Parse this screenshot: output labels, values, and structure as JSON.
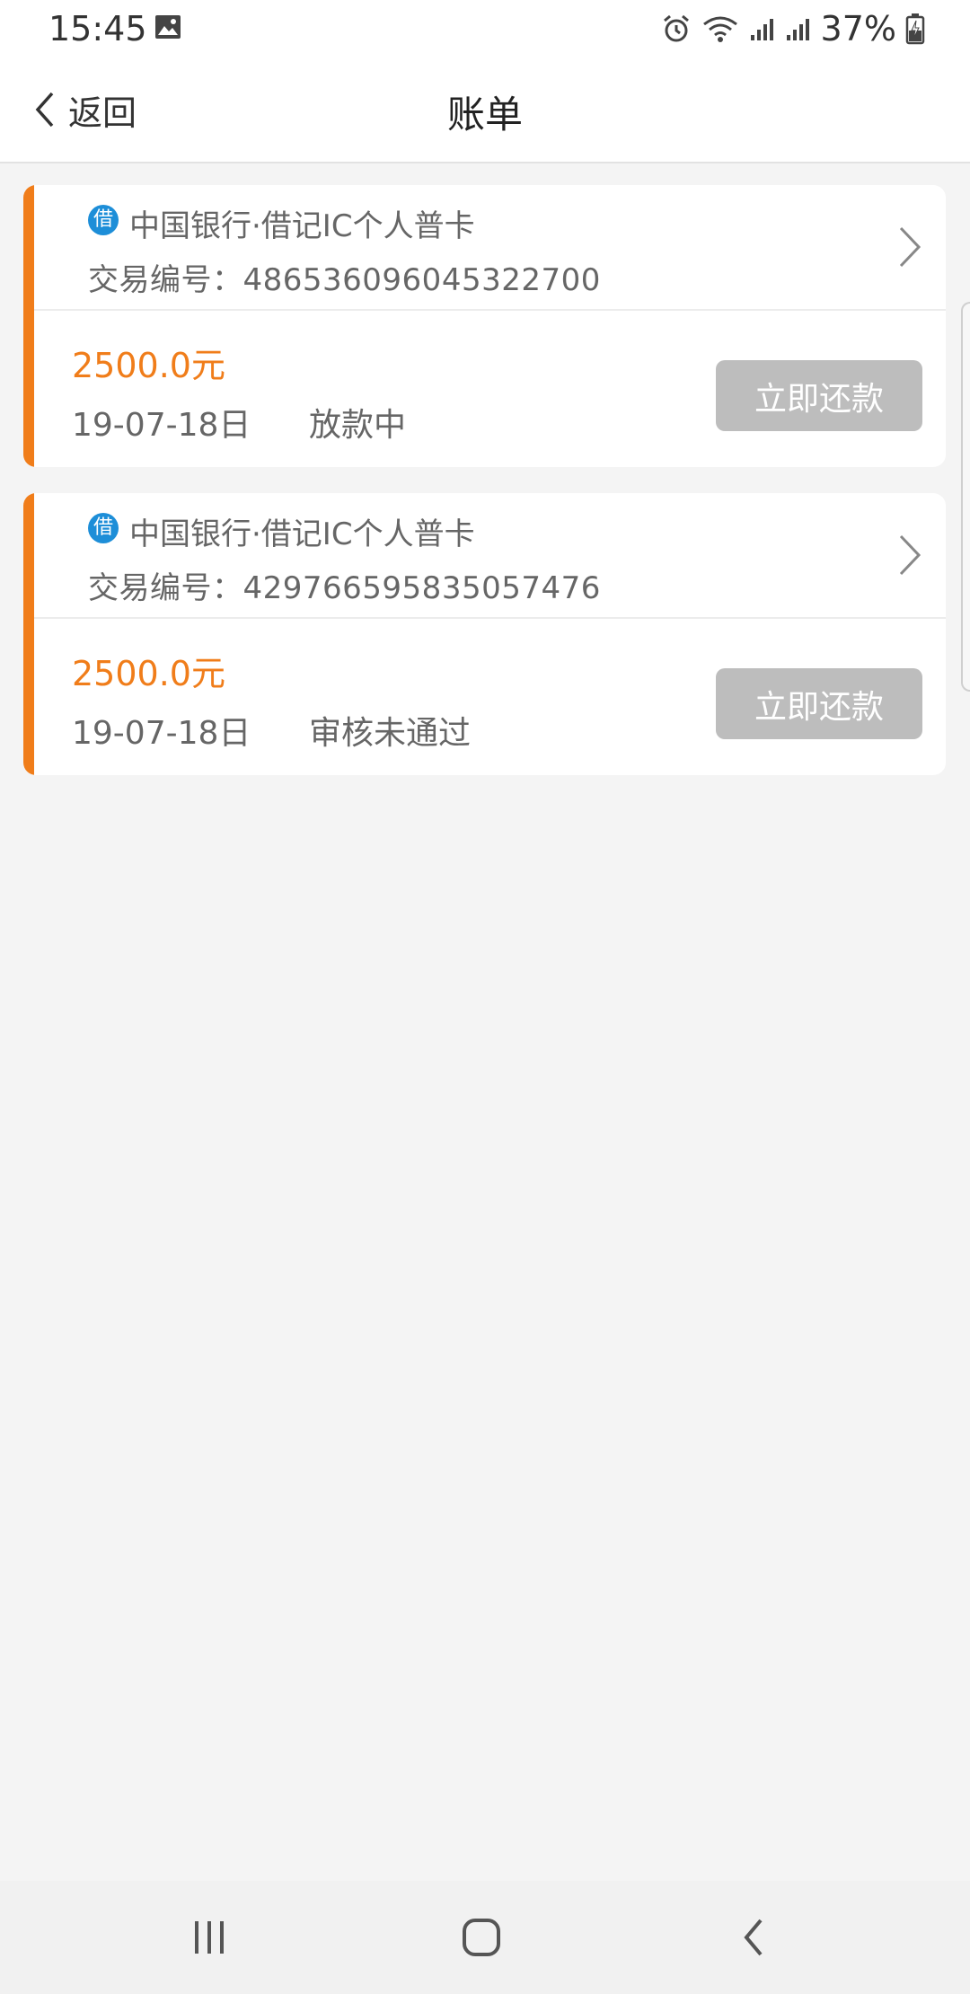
{
  "status_bar": {
    "time": "15:45",
    "battery_percent": "37%",
    "icons": [
      "gallery-icon",
      "alarm-icon",
      "wifi-icon",
      "signal-icon",
      "signal-icon",
      "battery-charging-icon"
    ]
  },
  "header": {
    "back_label": "返回",
    "title": "账单"
  },
  "bills": [
    {
      "bank": "中国银行·借记IC个人普卡",
      "bank_icon_glyph": "借",
      "txn_label": "交易编号：",
      "txn_number": "486536096045322700",
      "amount": "2500.0元",
      "date": "19-07-18日",
      "status": "放款中",
      "button_label": "立即还款"
    },
    {
      "bank": "中国银行·借记IC个人普卡",
      "bank_icon_glyph": "借",
      "txn_label": "交易编号：",
      "txn_number": "429766595835057476",
      "amount": "2500.0元",
      "date": "19-07-18日",
      "status": "审核未通过",
      "button_label": "立即还款"
    }
  ],
  "colors": {
    "accent": "#f07d1a",
    "bank_icon": "#1d8ed8",
    "button_disabled": "#bdbdbd",
    "background": "#f4f4f4"
  },
  "nav": {
    "icons": [
      "recent-apps-icon",
      "home-icon",
      "back-icon"
    ]
  }
}
